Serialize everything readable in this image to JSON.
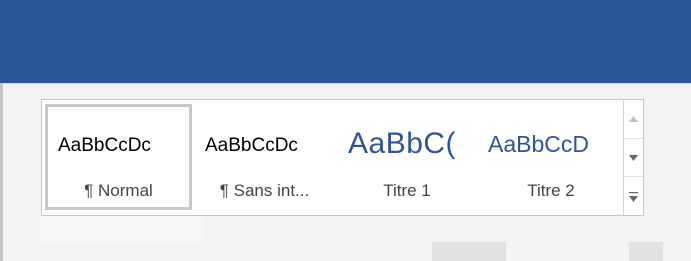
{
  "colors": {
    "title_bar": "#2b579a",
    "ribbon_bg": "#f3f3f3",
    "heading_blue": "#2f5597"
  },
  "styles_gallery": {
    "items": [
      {
        "preview": "AaBbCcDc",
        "label": "¶ Normal",
        "selected": true
      },
      {
        "preview": "AaBbCcDc",
        "label": "¶ Sans int...",
        "selected": false
      },
      {
        "preview": "AaBbC(",
        "label": "Titre 1",
        "selected": false
      },
      {
        "preview": "AaBbCcD",
        "label": "Titre 2",
        "selected": false
      }
    ],
    "scroll": {
      "up_icon": "triangle-up-icon",
      "down_icon": "triangle-down-icon",
      "more_icon": "gallery-more-icon"
    }
  }
}
